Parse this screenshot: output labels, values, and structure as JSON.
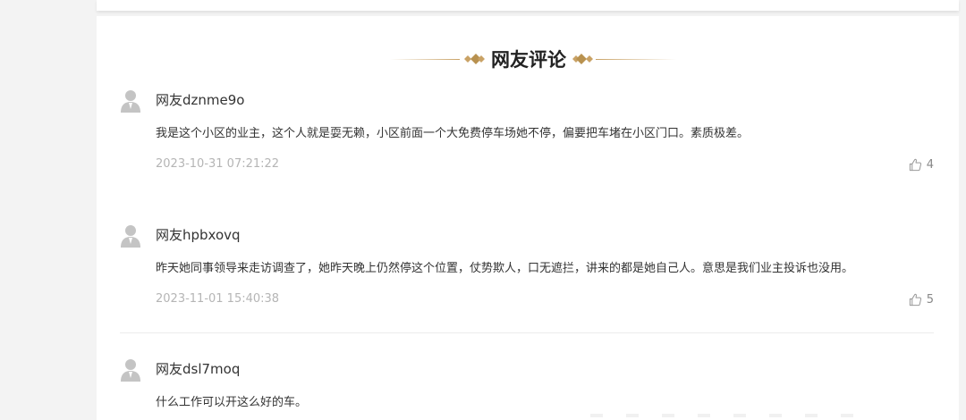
{
  "section": {
    "title": "网友评论"
  },
  "comments": [
    {
      "user": "网友dznme9o",
      "text": "我是这个小区的业主，这个人就是耍无赖，小区前面一个大免费停车场她不停，偏要把车堵在小区门口。素质极差。",
      "time": "2023-10-31 07:21:22",
      "likes": "4"
    },
    {
      "user": "网友hpbxovq",
      "text": "昨天她同事领导来走访调查了，她昨天晚上仍然停这个位置，仗势欺人，口无遮拦，讲来的都是她自己人。意思是我们业主投诉也没用。",
      "time": "2023-11-01 15:40:38",
      "likes": "5"
    },
    {
      "user": "网友dsl7moq",
      "text": "什么工作可以开这么好的车。"
    }
  ],
  "colors": {
    "gold_accent": "#c9a265",
    "time_text": "#b5b5b5",
    "avatar": "#c4c4c4"
  },
  "icons": {
    "avatar": "user-avatar-icon",
    "like": "thumbs-up-icon",
    "ornament": "diamond-ornament-icon"
  }
}
